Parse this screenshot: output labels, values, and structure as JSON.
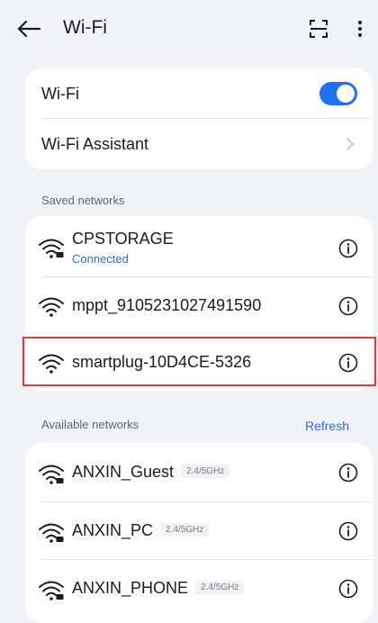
{
  "header": {
    "title": "Wi-Fi",
    "back_icon": "back-arrow-icon",
    "scan_icon": "scan-icon",
    "more_icon": "more-vertical-icon"
  },
  "wifi_card": {
    "wifi_label": "Wi-Fi",
    "wifi_enabled": true,
    "assistant_label": "Wi-Fi Assistant"
  },
  "saved": {
    "section_title": "Saved networks",
    "networks": [
      {
        "name": "CPSTORAGE",
        "status": "Connected",
        "secured": true
      },
      {
        "name": "mppt_9105231027491590"
      },
      {
        "name": "smartplug-10D4CE-5326"
      }
    ]
  },
  "available": {
    "section_title": "Available networks",
    "refresh_label": "Refresh",
    "networks": [
      {
        "name": "ANXIN_Guest",
        "band": "2.4/5GHz",
        "secured": true
      },
      {
        "name": "ANXIN_PC",
        "band": "2.4/5GHz",
        "secured": true
      },
      {
        "name": "ANXIN_PHONE",
        "band": "2.4/5GHz",
        "secured": true
      }
    ]
  },
  "colors": {
    "accent": "#1f6ff2",
    "highlight": "#e53935",
    "background": "#f1f2f6"
  }
}
